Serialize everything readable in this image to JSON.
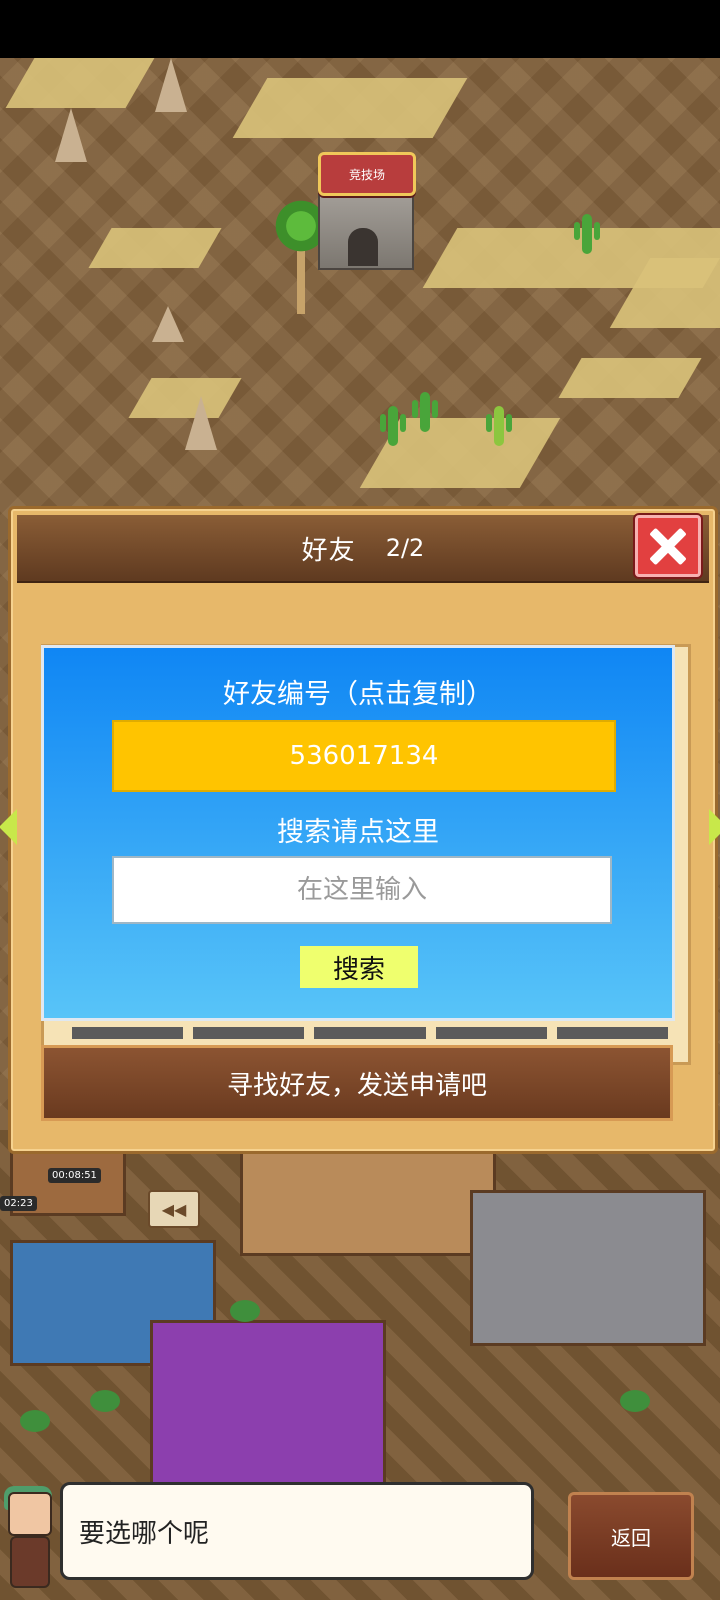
{
  "world": {
    "arena_label": "竞技场",
    "timers": [
      "00:08:51",
      "02:23"
    ]
  },
  "friends_dialog": {
    "title": "好友",
    "count": "2/2",
    "id_label": "好友编号（点击复制）",
    "friend_id": "536017134",
    "search_label": "搜索请点这里",
    "search_placeholder": "在这里输入",
    "search_button": "搜索",
    "banner": "寻找好友，发送申请吧"
  },
  "bottom_bar": {
    "speech": "要选哪个呢",
    "back_button": "返回"
  },
  "colors": {
    "panel_blue": "#0f86f4",
    "id_box_yellow": "#ffc400",
    "search_button": "#efff6e",
    "close_red": "#e24040",
    "header_brown": "#5f3a20"
  }
}
